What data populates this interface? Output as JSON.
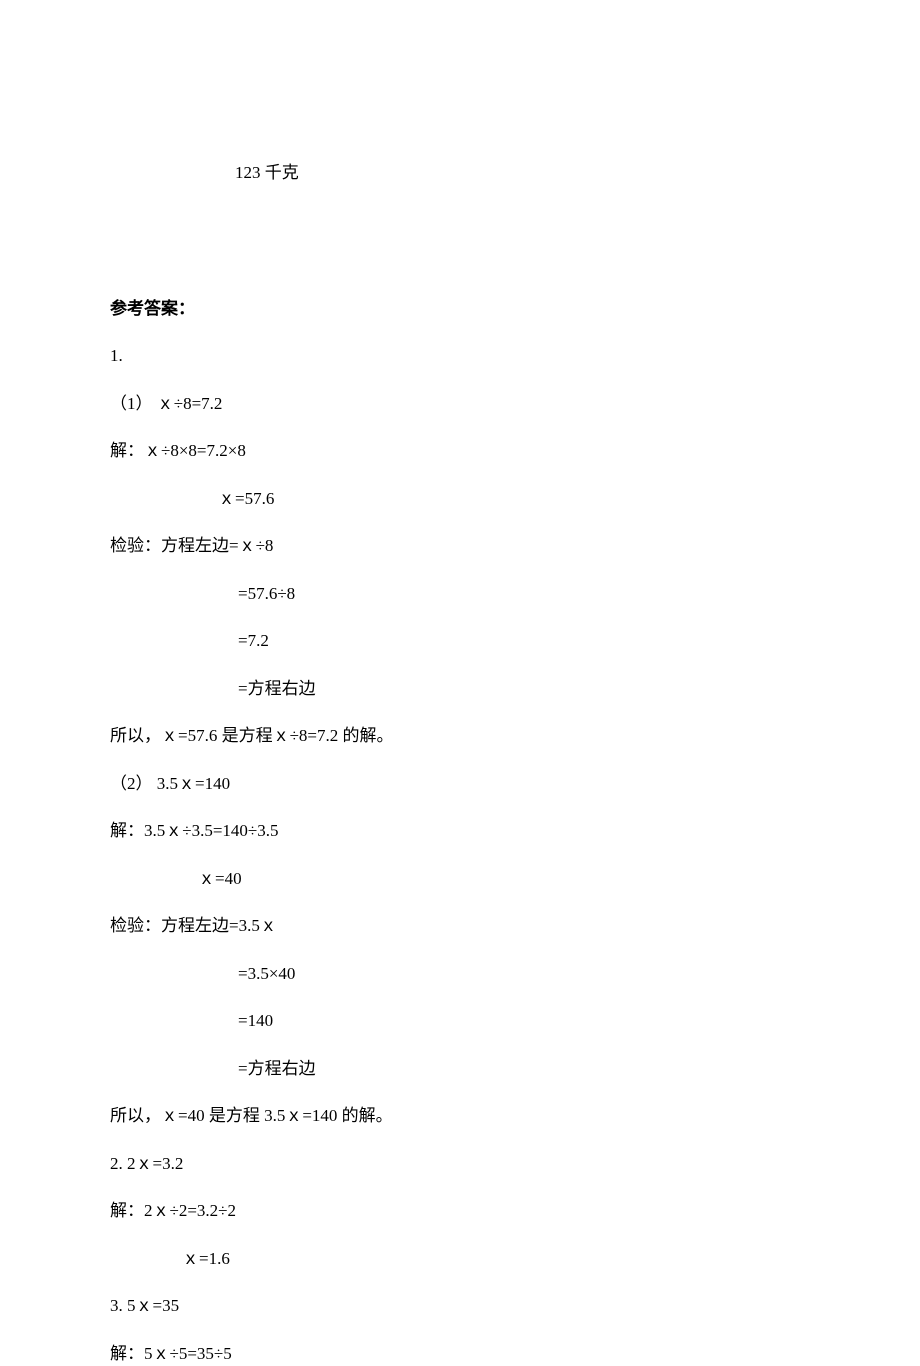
{
  "top": "123 千克",
  "answer_heading": "参考答案：",
  "lines": {
    "q1": "1.",
    "p1_eq": "（1）  ｘ÷8=7.2",
    "p1_s1": "解：ｘ÷8×8=7.2×8",
    "p1_s2": "ｘ=57.6",
    "p1_c1": "检验：方程左边=ｘ÷8",
    "p1_c2": "=57.6÷8",
    "p1_c3": "=7.2",
    "p1_c4": "=方程右边",
    "p1_conc": "所以，ｘ=57.6 是方程ｘ÷8=7.2 的解。",
    "p2_eq": "（2）   3.5ｘ=140",
    "p2_s1": "解：3.5ｘ÷3.5=140÷3.5",
    "p2_s2": "ｘ=40",
    "p2_c1": "检验：方程左边=3.5ｘ",
    "p2_c2": "=3.5×40",
    "p2_c3": "=140",
    "p2_c4": "=方程右边",
    "p2_conc": "所以，ｘ=40 是方程 3.5ｘ=140 的解。",
    "q2": "2.    2ｘ=3.2",
    "q2_s1": "解：2ｘ÷2=3.2÷2",
    "q2_s2": "ｘ=1.6",
    "q3": "3.    5ｘ=35",
    "q3_s1": "解：5ｘ÷5=35÷5"
  }
}
